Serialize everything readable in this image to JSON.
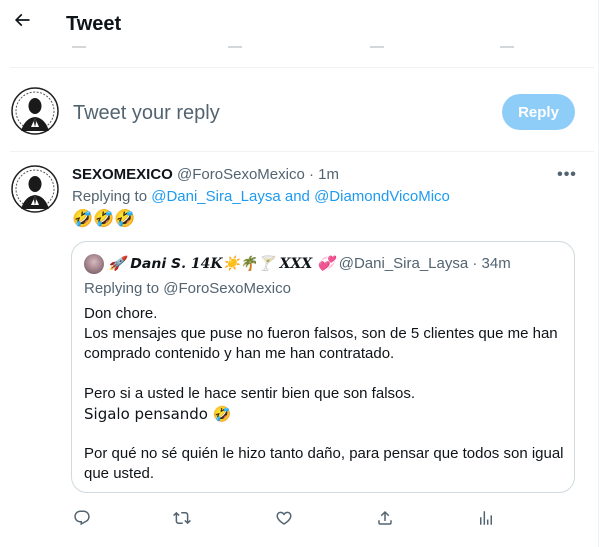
{
  "header": {
    "title": "Tweet",
    "back_icon": "arrow-left-icon"
  },
  "composer": {
    "placeholder": "Tweet your reply",
    "reply_button": "Reply"
  },
  "tweet": {
    "author_name": "SEXOMEXICO",
    "author_handle": "@ForoSexoMexico",
    "separator": "·",
    "time": "1m",
    "replying_prefix": "Replying to ",
    "replying_user1": "@Dani_Sira_Laysa",
    "replying_and": " and ",
    "replying_user2": "@DiamondVicoMico",
    "text": "🤣🤣🤣",
    "more_icon": "more-horizontal-icon",
    "quote": {
      "author_name": "🚀 𝘿𝙖𝙣𝙞 𝙎. 14K☀️🌴🍸 XXX 💞",
      "author_handle": "@Dani_Sira_Laysa",
      "time": "34m",
      "replying": "Replying to @ForoSexoMexico",
      "lines": [
        "Don chore.",
        "Los mensajes que puse no fueron falsos, son de 5 clientes que me han",
        "comprado contenido y han me han contratado.",
        "",
        "Pero si a usted le hace sentir bien que son falsos.",
        "Sigalo pensando 🤣",
        "",
        "Por qué no sé quién le hizo tanto daño, para pensar que todos son igual",
        "que usted."
      ]
    },
    "actions": [
      {
        "name": "reply-icon"
      },
      {
        "name": "retweet-icon"
      },
      {
        "name": "like-icon"
      },
      {
        "name": "share-icon"
      },
      {
        "name": "analytics-icon"
      }
    ]
  },
  "colors": {
    "accent": "#1d9bf0",
    "reply_button_disabled": "#8ecdf8",
    "muted_text": "#536471",
    "border": "#cfd9de"
  }
}
